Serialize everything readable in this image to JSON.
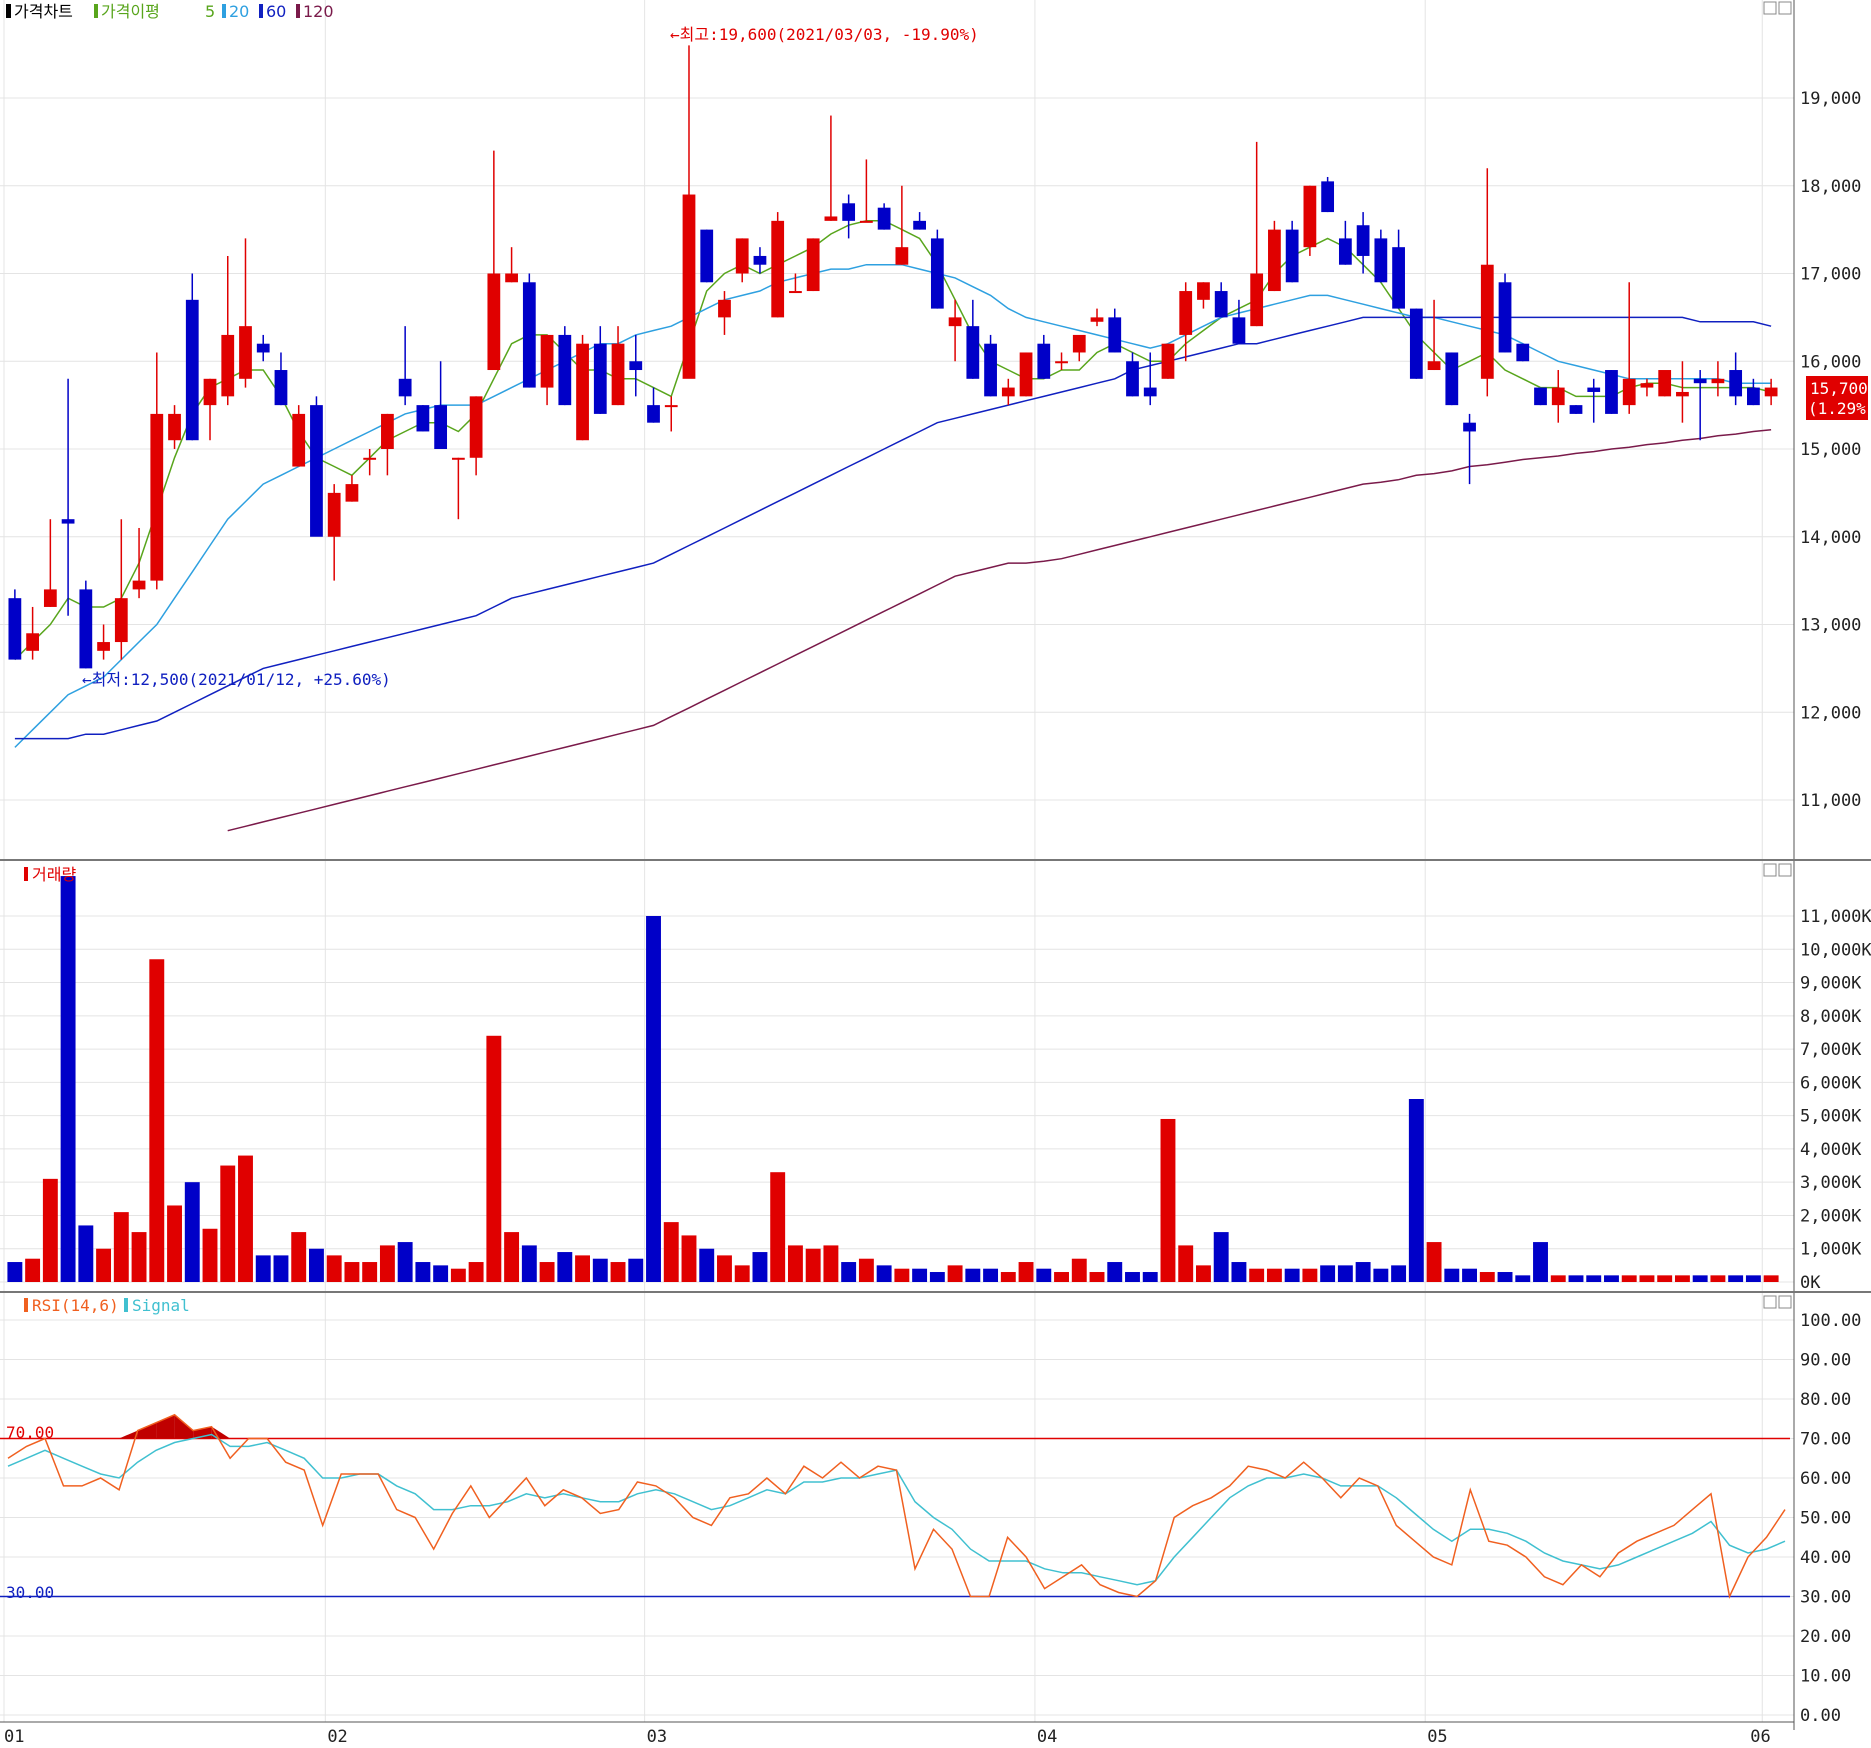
{
  "price_panel": {
    "title": "가격차트",
    "ma_label": "가격이평",
    "ma_periods": [
      "5",
      "20",
      "60",
      "120"
    ],
    "ma_colors": [
      "#58a51c",
      "#2ea0e0",
      "#1020c0",
      "#7a1a4a"
    ],
    "high_annotation": "←최고:19,600(2021/03/03, -19.90%)",
    "low_annotation": "←최저:12,500(2021/01/12, +25.60%)",
    "current_price": "15,700",
    "current_change": "(1.29%)",
    "y_ticks": [
      "19,000",
      "18,000",
      "17,000",
      "16,000",
      "15,000",
      "14,000",
      "13,000",
      "12,000",
      "11,000"
    ]
  },
  "volume_panel": {
    "title": "거래량",
    "y_ticks": [
      "11,000K",
      "10,000K",
      "9,000K",
      "8,000K",
      "7,000K",
      "6,000K",
      "5,000K",
      "4,000K",
      "3,000K",
      "2,000K",
      "1,000K",
      "0K"
    ]
  },
  "rsi_panel": {
    "rsi_label": "RSI(14,6)",
    "signal_label": "Signal",
    "level_high": "70.00",
    "level_low": "30.00",
    "y_ticks": [
      "100.00",
      "90.00",
      "80.00",
      "70.00",
      "60.00",
      "50.00",
      "40.00",
      "30.00",
      "20.00",
      "10.00",
      "0.00"
    ]
  },
  "x_axis": {
    "labels": [
      "01",
      "02",
      "03",
      "04",
      "05",
      "06"
    ]
  },
  "colors": {
    "up": "#e00000",
    "down": "#0000c8",
    "rsi": "#f06020",
    "signal": "#40c0d0"
  },
  "chart_data": {
    "type": "candlestick",
    "x_months": [
      "01",
      "02",
      "03",
      "04",
      "05",
      "06"
    ],
    "candles": [
      [
        13.3,
        13.4,
        12.6,
        12.6
      ],
      [
        12.7,
        13.2,
        12.6,
        12.9
      ],
      [
        13.2,
        14.2,
        13.2,
        13.4
      ],
      [
        14.2,
        15.8,
        13.1,
        14.15
      ],
      [
        13.4,
        13.5,
        12.5,
        12.5
      ],
      [
        12.7,
        13.0,
        12.6,
        12.8
      ],
      [
        12.8,
        14.2,
        12.6,
        13.3
      ],
      [
        13.4,
        14.1,
        13.3,
        13.5
      ],
      [
        13.5,
        16.1,
        13.4,
        15.4
      ],
      [
        15.1,
        15.5,
        15.0,
        15.4
      ],
      [
        16.7,
        17.0,
        15.1,
        15.1
      ],
      [
        15.5,
        15.8,
        15.1,
        15.8
      ],
      [
        15.6,
        17.2,
        15.5,
        16.3
      ],
      [
        15.8,
        17.4,
        15.7,
        16.4
      ],
      [
        16.2,
        16.3,
        16.0,
        16.1
      ],
      [
        15.9,
        16.1,
        15.5,
        15.5
      ],
      [
        14.8,
        15.5,
        14.8,
        15.4
      ],
      [
        15.5,
        15.6,
        14.8,
        14.0
      ],
      [
        14.0,
        14.6,
        13.5,
        14.5
      ],
      [
        14.4,
        14.7,
        14.4,
        14.6
      ],
      [
        14.9,
        15.0,
        14.7,
        14.9
      ],
      [
        15.0,
        15.4,
        14.7,
        15.4
      ],
      [
        15.8,
        16.4,
        15.5,
        15.6
      ],
      [
        15.5,
        15.5,
        15.2,
        15.2
      ],
      [
        15.5,
        16.0,
        15.0,
        15.0
      ],
      [
        14.9,
        14.9,
        14.2,
        14.9
      ],
      [
        14.9,
        15.6,
        14.7,
        15.6
      ],
      [
        15.9,
        18.4,
        15.9,
        17.0
      ],
      [
        16.9,
        17.3,
        16.9,
        17.0
      ],
      [
        16.9,
        17.0,
        15.7,
        15.7
      ],
      [
        15.7,
        16.3,
        15.5,
        16.3
      ],
      [
        16.3,
        16.4,
        15.5,
        15.5
      ],
      [
        15.1,
        16.3,
        15.1,
        16.2
      ],
      [
        16.2,
        16.4,
        15.4,
        15.4
      ],
      [
        15.5,
        16.4,
        15.5,
        16.2
      ],
      [
        16.0,
        16.3,
        15.6,
        15.9
      ],
      [
        15.5,
        15.7,
        15.3,
        15.3
      ],
      [
        15.5,
        15.6,
        15.2,
        15.5
      ],
      [
        15.8,
        19.6,
        15.9,
        17.9
      ],
      [
        17.5,
        17.5,
        16.9,
        16.9
      ],
      [
        16.5,
        16.8,
        16.3,
        16.7
      ],
      [
        17.0,
        17.4,
        16.9,
        17.4
      ],
      [
        17.2,
        17.3,
        17.0,
        17.1
      ],
      [
        16.5,
        17.7,
        16.5,
        17.6
      ],
      [
        16.8,
        17.0,
        16.8,
        16.8
      ],
      [
        16.8,
        17.4,
        16.8,
        17.4
      ],
      [
        17.6,
        18.8,
        17.6,
        17.65
      ],
      [
        17.8,
        17.9,
        17.4,
        17.6
      ],
      [
        17.6,
        18.3,
        17.6,
        17.6
      ],
      [
        17.75,
        17.8,
        17.5,
        17.5
      ],
      [
        17.1,
        18.0,
        17.1,
        17.3
      ],
      [
        17.6,
        17.7,
        17.5,
        17.5
      ],
      [
        17.4,
        17.5,
        16.6,
        16.6
      ],
      [
        16.4,
        16.7,
        16.0,
        16.5
      ],
      [
        16.4,
        16.7,
        15.8,
        15.8
      ],
      [
        16.2,
        16.3,
        15.6,
        15.6
      ],
      [
        15.6,
        15.8,
        15.5,
        15.7
      ],
      [
        15.6,
        16.1,
        15.6,
        16.1
      ],
      [
        16.2,
        16.3,
        15.8,
        15.8
      ],
      [
        16.0,
        16.1,
        15.9,
        16.0
      ],
      [
        16.1,
        16.2,
        16.0,
        16.3
      ],
      [
        16.45,
        16.6,
        16.4,
        16.5
      ],
      [
        16.5,
        16.6,
        16.1,
        16.1
      ],
      [
        16.0,
        16.1,
        15.6,
        15.6
      ],
      [
        15.7,
        16.1,
        15.5,
        15.6
      ],
      [
        15.8,
        16.2,
        15.8,
        16.2
      ],
      [
        16.3,
        16.9,
        16.0,
        16.8
      ],
      [
        16.7,
        16.9,
        16.6,
        16.9
      ],
      [
        16.8,
        16.9,
        16.5,
        16.5
      ],
      [
        16.5,
        16.7,
        16.2,
        16.2
      ],
      [
        16.4,
        18.5,
        16.4,
        17.0
      ],
      [
        16.8,
        17.6,
        16.8,
        17.5
      ],
      [
        17.5,
        17.6,
        16.9,
        16.9
      ],
      [
        17.3,
        18.0,
        17.2,
        18.0
      ],
      [
        18.05,
        18.1,
        17.7,
        17.7
      ],
      [
        17.4,
        17.6,
        17.1,
        17.1
      ],
      [
        17.55,
        17.7,
        17.0,
        17.2
      ],
      [
        17.4,
        17.5,
        16.9,
        16.9
      ],
      [
        17.3,
        17.5,
        16.6,
        16.6
      ],
      [
        16.6,
        16.6,
        15.8,
        15.8
      ],
      [
        15.9,
        16.7,
        15.9,
        16.0
      ],
      [
        16.1,
        16.1,
        15.5,
        15.5
      ],
      [
        15.3,
        15.4,
        14.6,
        15.2
      ],
      [
        15.8,
        18.2,
        15.6,
        17.1
      ],
      [
        16.9,
        17.0,
        16.1,
        16.1
      ],
      [
        16.2,
        16.2,
        16.0,
        16.0
      ],
      [
        15.7,
        15.7,
        15.5,
        15.5
      ],
      [
        15.5,
        15.9,
        15.3,
        15.7
      ],
      [
        15.5,
        15.5,
        15.4,
        15.4
      ],
      [
        15.7,
        15.8,
        15.3,
        15.65
      ],
      [
        15.9,
        15.9,
        15.4,
        15.4
      ],
      [
        15.5,
        16.9,
        15.4,
        15.8
      ],
      [
        15.7,
        15.8,
        15.6,
        15.75
      ],
      [
        15.6,
        15.8,
        15.6,
        15.9
      ],
      [
        15.6,
        16.0,
        15.3,
        15.65
      ],
      [
        15.8,
        15.9,
        15.1,
        15.75
      ],
      [
        15.75,
        16.0,
        15.6,
        15.8
      ],
      [
        15.9,
        16.1,
        15.5,
        15.6
      ],
      [
        15.7,
        15.8,
        15.5,
        15.5
      ],
      [
        15.6,
        15.8,
        15.5,
        15.7
      ]
    ],
    "volumes": [
      600,
      700,
      3100,
      12200,
      1700,
      1000,
      2100,
      1500,
      9700,
      2300,
      3000,
      1600,
      3500,
      3800,
      800,
      800,
      1500,
      1000,
      800,
      600,
      600,
      1100,
      1200,
      600,
      500,
      400,
      600,
      7400,
      1500,
      1100,
      600,
      900,
      800,
      700,
      600,
      700,
      11000,
      1800,
      1400,
      1000,
      800,
      500,
      900,
      3300,
      1100,
      1000,
      1100,
      600,
      700,
      500,
      400,
      400,
      300,
      500,
      400,
      400,
      300,
      600,
      400,
      300,
      700,
      300,
      600,
      300,
      300,
      4900,
      1100,
      500,
      1500,
      600,
      400,
      400,
      400,
      400,
      500,
      500,
      600,
      400,
      500,
      5500,
      1200,
      400,
      400,
      300,
      300,
      200,
      1200,
      200,
      200,
      200,
      200,
      200,
      200,
      200,
      200,
      200,
      200,
      200,
      200,
      200
    ],
    "ma5": [
      12.6,
      12.8,
      13.0,
      13.3,
      13.2,
      13.2,
      13.3,
      13.7,
      14.3,
      14.9,
      15.4,
      15.7,
      15.8,
      15.9,
      15.9,
      15.6,
      15.2,
      14.9,
      14.8,
      14.7,
      14.9,
      15.1,
      15.2,
      15.3,
      15.3,
      15.2,
      15.4,
      15.8,
      16.2,
      16.3,
      16.3,
      16.1,
      15.9,
      15.9,
      15.8,
      15.8,
      15.7,
      15.6,
      16.2,
      16.8,
      17.0,
      17.1,
      17.0,
      17.1,
      17.2,
      17.3,
      17.45,
      17.55,
      17.6,
      17.6,
      17.5,
      17.4,
      17.1,
      16.7,
      16.3,
      16.0,
      15.9,
      15.8,
      15.8,
      15.9,
      15.9,
      16.1,
      16.2,
      16.1,
      16.0,
      16.0,
      16.2,
      16.35,
      16.5,
      16.6,
      16.7,
      17.0,
      17.2,
      17.3,
      17.4,
      17.3,
      17.1,
      16.9,
      16.6,
      16.3,
      16.1,
      15.9,
      16.0,
      16.1,
      15.9,
      15.8,
      15.7,
      15.7,
      15.6,
      15.6,
      15.6,
      15.7,
      15.75,
      15.75,
      15.7,
      15.7,
      15.7,
      15.7,
      15.7,
      15.65
    ],
    "ma20": [
      11.6,
      11.8,
      12.0,
      12.2,
      12.3,
      12.4,
      12.6,
      12.8,
      13.0,
      13.3,
      13.6,
      13.9,
      14.2,
      14.4,
      14.6,
      14.7,
      14.8,
      14.9,
      15.0,
      15.1,
      15.2,
      15.3,
      15.4,
      15.45,
      15.5,
      15.5,
      15.5,
      15.6,
      15.7,
      15.8,
      15.9,
      16.0,
      16.1,
      16.2,
      16.2,
      16.3,
      16.35,
      16.4,
      16.5,
      16.6,
      16.7,
      16.75,
      16.8,
      16.9,
      16.95,
      17.0,
      17.05,
      17.05,
      17.1,
      17.1,
      17.1,
      17.05,
      17.0,
      16.95,
      16.85,
      16.75,
      16.6,
      16.5,
      16.45,
      16.4,
      16.35,
      16.3,
      16.25,
      16.2,
      16.15,
      16.2,
      16.3,
      16.4,
      16.5,
      16.55,
      16.6,
      16.65,
      16.7,
      16.75,
      16.75,
      16.7,
      16.65,
      16.6,
      16.55,
      16.5,
      16.5,
      16.45,
      16.4,
      16.35,
      16.3,
      16.2,
      16.1,
      16.0,
      15.95,
      15.9,
      15.85,
      15.8,
      15.8,
      15.8,
      15.8,
      15.8,
      15.8,
      15.75,
      15.75,
      15.75
    ],
    "ma60": [
      11.7,
      11.7,
      11.7,
      11.7,
      11.75,
      11.75,
      11.8,
      11.85,
      11.9,
      12.0,
      12.1,
      12.2,
      12.3,
      12.4,
      12.5,
      12.55,
      12.6,
      12.65,
      12.7,
      12.75,
      12.8,
      12.85,
      12.9,
      12.95,
      13.0,
      13.05,
      13.1,
      13.2,
      13.3,
      13.35,
      13.4,
      13.45,
      13.5,
      13.55,
      13.6,
      13.65,
      13.7,
      13.8,
      13.9,
      14.0,
      14.1,
      14.2,
      14.3,
      14.4,
      14.5,
      14.6,
      14.7,
      14.8,
      14.9,
      15.0,
      15.1,
      15.2,
      15.3,
      15.35,
      15.4,
      15.45,
      15.5,
      15.55,
      15.6,
      15.65,
      15.7,
      15.75,
      15.8,
      15.9,
      15.95,
      16.0,
      16.05,
      16.1,
      16.15,
      16.2,
      16.2,
      16.25,
      16.3,
      16.35,
      16.4,
      16.45,
      16.5,
      16.5,
      16.5,
      16.5,
      16.5,
      16.5,
      16.5,
      16.5,
      16.5,
      16.5,
      16.5,
      16.5,
      16.5,
      16.5,
      16.5,
      16.5,
      16.5,
      16.5,
      16.5,
      16.45,
      16.45,
      16.45,
      16.45,
      16.4
    ],
    "ma120": [
      10.65,
      10.7,
      10.75,
      10.8,
      10.85,
      10.9,
      10.95,
      11.0,
      11.05,
      11.1,
      11.15,
      11.2,
      11.25,
      11.3,
      11.35,
      11.4,
      11.45,
      11.5,
      11.55,
      11.6,
      11.65,
      11.7,
      11.75,
      11.8,
      11.85,
      11.95,
      12.05,
      12.15,
      12.25,
      12.35,
      12.45,
      12.55,
      12.65,
      12.75,
      12.85,
      12.95,
      13.05,
      13.15,
      13.25,
      13.35,
      13.45,
      13.55,
      13.6,
      13.65,
      13.7,
      13.7,
      13.72,
      13.75,
      13.8,
      13.85,
      13.9,
      13.95,
      14.0,
      14.05,
      14.1,
      14.15,
      14.2,
      14.25,
      14.3,
      14.35,
      14.4,
      14.45,
      14.5,
      14.55,
      14.6,
      14.62,
      14.65,
      14.7,
      14.72,
      14.75,
      14.8,
      14.82,
      14.85,
      14.88,
      14.9,
      14.92,
      14.95,
      14.97,
      15.0,
      15.02,
      15.05,
      15.07,
      15.1,
      15.12,
      15.15,
      15.17,
      15.2,
      15.22
    ],
    "rsi": [
      65,
      68,
      70,
      58,
      58,
      60,
      57,
      72,
      74,
      76,
      72,
      73,
      65,
      70,
      70,
      64,
      62,
      48,
      61,
      61,
      61,
      52,
      50,
      42,
      51,
      58,
      50,
      55,
      60,
      53,
      57,
      55,
      51,
      52,
      59,
      58,
      55,
      50,
      48,
      55,
      56,
      60,
      56,
      63,
      60,
      64,
      60,
      63,
      62,
      37,
      47,
      42,
      30,
      30,
      45,
      40,
      32,
      35,
      38,
      33,
      31,
      30,
      34,
      50,
      53,
      55,
      58,
      63,
      62,
      60,
      64,
      60,
      55,
      60,
      58,
      48,
      44,
      40,
      38,
      57,
      44,
      43,
      40,
      35,
      33,
      38,
      35,
      41,
      44,
      46,
      48,
      52,
      56,
      30,
      40,
      45,
      52
    ],
    "signal": [
      63,
      65,
      67,
      65,
      63,
      61,
      60,
      64,
      67,
      69,
      70,
      71,
      68,
      68,
      69,
      67,
      65,
      60,
      60,
      61,
      61,
      58,
      56,
      52,
      52,
      53,
      53,
      54,
      56,
      55,
      56,
      55,
      54,
      54,
      56,
      57,
      56,
      54,
      52,
      53,
      55,
      57,
      56,
      59,
      59,
      60,
      60,
      61,
      62,
      54,
      50,
      47,
      42,
      39,
      39,
      39,
      37,
      36,
      36,
      35,
      34,
      33,
      34,
      40,
      45,
      50,
      55,
      58,
      60,
      60,
      61,
      60,
      58,
      58,
      58,
      55,
      51,
      47,
      44,
      47,
      47,
      46,
      44,
      41,
      39,
      38,
      37,
      38,
      40,
      42,
      44,
      46,
      49,
      43,
      41,
      42,
      44
    ],
    "rsi_levels": [
      70,
      30
    ],
    "price_ylim": [
      10.5,
      19.9
    ],
    "volume_ylim": [
      0,
      12000
    ],
    "rsi_ylim": [
      0,
      100
    ]
  }
}
